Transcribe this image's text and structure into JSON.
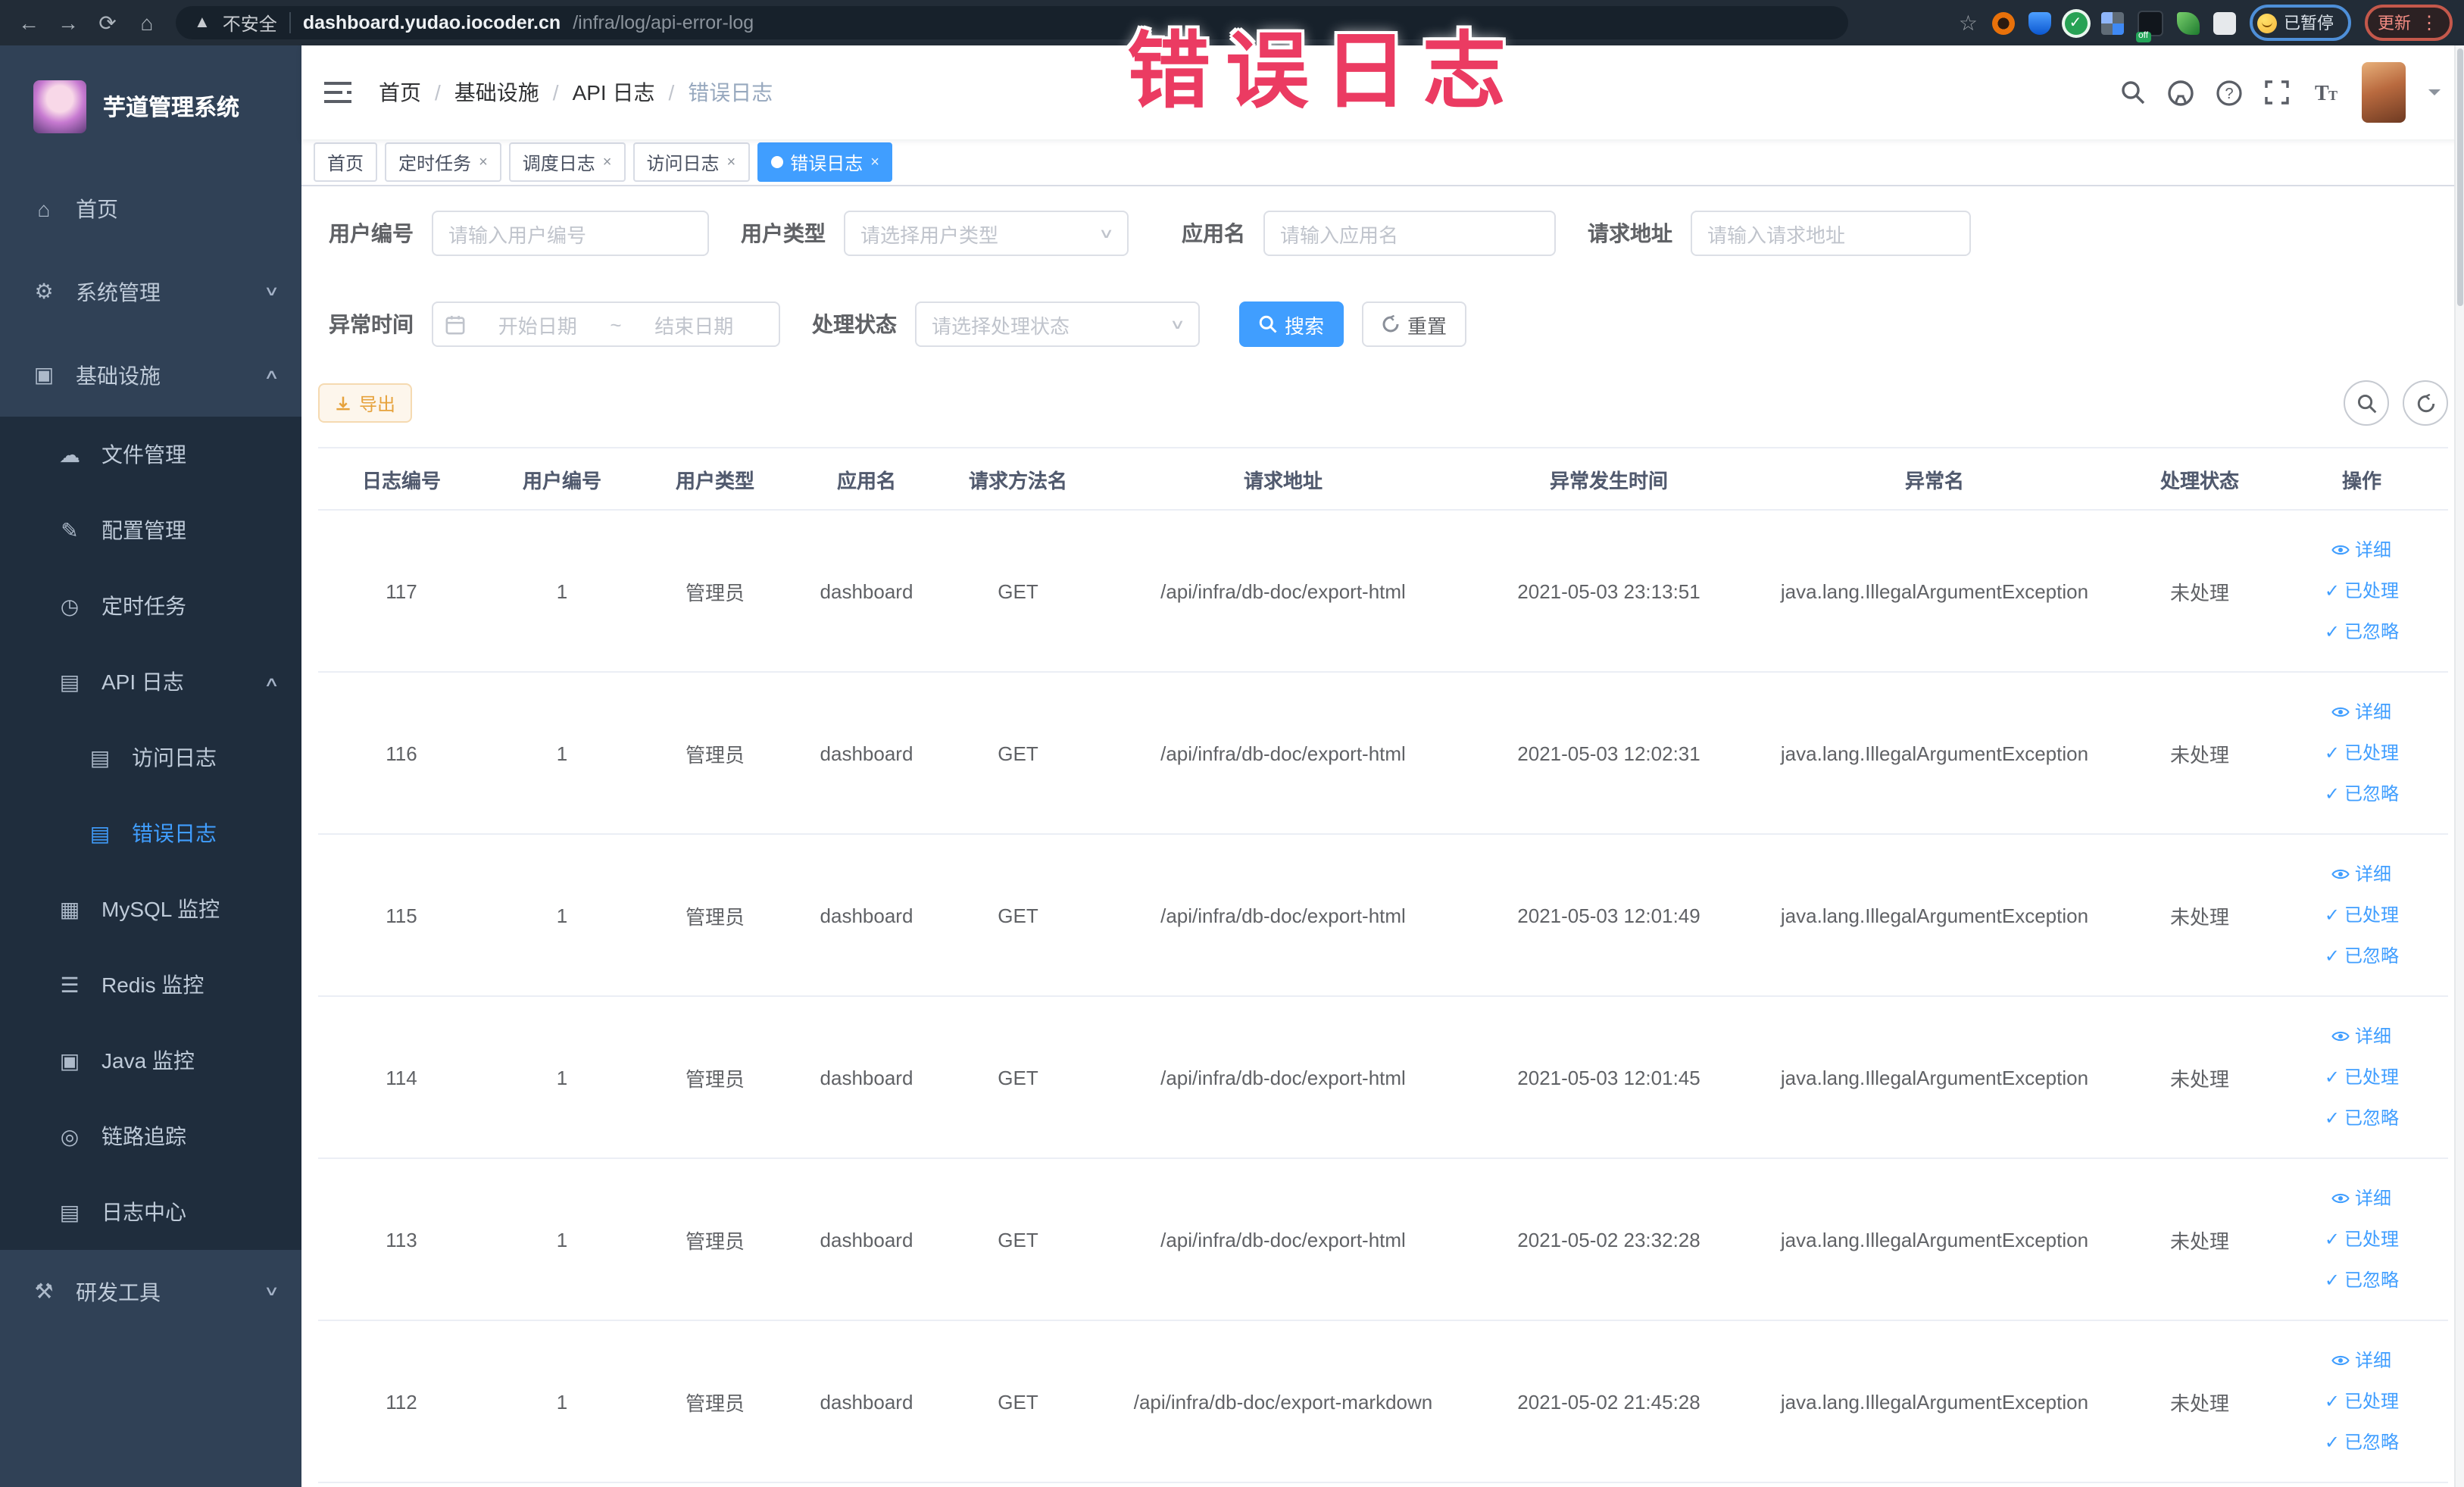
{
  "colors": {
    "primary": "#409EFF",
    "warning_text": "#E6A23C",
    "overlay_title": "#EB3B62",
    "sidebar_bg": "#304156",
    "sidebar_submenu_bg": "#1F2D3D",
    "active_tab_bg": "#409EFF"
  },
  "overlay": {
    "title": "错误日志"
  },
  "browser": {
    "security_label": "不安全",
    "url_host": "dashboard.yudao.iocoder.cn",
    "url_path": "/infra/log/api-error-log",
    "paused_badge": "已暂停",
    "update_button": "更新"
  },
  "sidebar": {
    "logo_title": "芋道管理系统",
    "items": [
      {
        "key": "home",
        "label": "首页",
        "icon": "home-icon",
        "level": 1
      },
      {
        "key": "system-management",
        "label": "系统管理",
        "icon": "gear-icon",
        "level": 1,
        "chevron": "down"
      },
      {
        "key": "infrastructure",
        "label": "基础设施",
        "icon": "infrastructure-icon",
        "level": 1,
        "chevron": "up"
      },
      {
        "key": "file-management",
        "label": "文件管理",
        "icon": "file-icon",
        "level": 2
      },
      {
        "key": "config-management",
        "label": "配置管理",
        "icon": "config-icon",
        "level": 2
      },
      {
        "key": "scheduled-tasks",
        "label": "定时任务",
        "icon": "timer-icon",
        "level": 2
      },
      {
        "key": "api-log",
        "label": "API 日志",
        "icon": "api-log-icon",
        "level": 2,
        "chevron": "up"
      },
      {
        "key": "access-log",
        "label": "访问日志",
        "icon": "access-log-icon",
        "level": 3
      },
      {
        "key": "error-log",
        "label": "错误日志",
        "icon": "error-log-icon",
        "level": 3,
        "active": true
      },
      {
        "key": "mysql-monitor",
        "label": "MySQL 监控",
        "icon": "mysql-icon",
        "level": 2
      },
      {
        "key": "redis-monitor",
        "label": "Redis 监控",
        "icon": "redis-icon",
        "level": 2
      },
      {
        "key": "java-monitor",
        "label": "Java 监控",
        "icon": "java-icon",
        "level": 2
      },
      {
        "key": "trace",
        "label": "链路追踪",
        "icon": "trace-icon",
        "level": 2
      },
      {
        "key": "log-center",
        "label": "日志中心",
        "icon": "log-center-icon",
        "level": 2
      },
      {
        "key": "dev-tools",
        "label": "研发工具",
        "icon": "dev-tools-icon",
        "level": 1,
        "chevron": "down"
      }
    ]
  },
  "breadcrumb": {
    "items": [
      "首页",
      "基础设施",
      "API 日志",
      "错误日志"
    ]
  },
  "tabs": [
    {
      "label": "首页",
      "closable": false,
      "active": false
    },
    {
      "label": "定时任务",
      "closable": true,
      "active": false
    },
    {
      "label": "调度日志",
      "closable": true,
      "active": false
    },
    {
      "label": "访问日志",
      "closable": true,
      "active": false
    },
    {
      "label": "错误日志",
      "closable": true,
      "active": true
    }
  ],
  "filters": {
    "user_id": {
      "label": "用户编号",
      "placeholder": "请输入用户编号"
    },
    "user_type": {
      "label": "用户类型",
      "placeholder": "请选择用户类型"
    },
    "app_name": {
      "label": "应用名",
      "placeholder": "请输入应用名"
    },
    "request_url": {
      "label": "请求地址",
      "placeholder": "请输入请求地址"
    },
    "exception_time": {
      "label": "异常时间",
      "start_placeholder": "开始日期",
      "separator": "~",
      "end_placeholder": "结束日期"
    },
    "process_status": {
      "label": "处理状态",
      "placeholder": "请选择处理状态"
    },
    "search_label": "搜索",
    "reset_label": "重置"
  },
  "toolbar": {
    "export_label": "导出"
  },
  "table": {
    "columns": [
      "日志编号",
      "用户编号",
      "用户类型",
      "应用名",
      "请求方法名",
      "请求地址",
      "异常发生时间",
      "异常名",
      "处理状态",
      "操作"
    ],
    "actions": [
      "详细",
      "已处理",
      "已忽略"
    ],
    "rows": [
      {
        "id": "117",
        "user_id": "1",
        "user_type": "管理员",
        "app_name": "dashboard",
        "method": "GET",
        "url": "/api/infra/db-doc/export-html",
        "time": "2021-05-03 23:13:51",
        "exception": "java.lang.IllegalArgumentException",
        "status": "未处理"
      },
      {
        "id": "116",
        "user_id": "1",
        "user_type": "管理员",
        "app_name": "dashboard",
        "method": "GET",
        "url": "/api/infra/db-doc/export-html",
        "time": "2021-05-03 12:02:31",
        "exception": "java.lang.IllegalArgumentException",
        "status": "未处理"
      },
      {
        "id": "115",
        "user_id": "1",
        "user_type": "管理员",
        "app_name": "dashboard",
        "method": "GET",
        "url": "/api/infra/db-doc/export-html",
        "time": "2021-05-03 12:01:49",
        "exception": "java.lang.IllegalArgumentException",
        "status": "未处理"
      },
      {
        "id": "114",
        "user_id": "1",
        "user_type": "管理员",
        "app_name": "dashboard",
        "method": "GET",
        "url": "/api/infra/db-doc/export-html",
        "time": "2021-05-03 12:01:45",
        "exception": "java.lang.IllegalArgumentException",
        "status": "未处理"
      },
      {
        "id": "113",
        "user_id": "1",
        "user_type": "管理员",
        "app_name": "dashboard",
        "method": "GET",
        "url": "/api/infra/db-doc/export-html",
        "time": "2021-05-02 23:32:28",
        "exception": "java.lang.IllegalArgumentException",
        "status": "未处理"
      },
      {
        "id": "112",
        "user_id": "1",
        "user_type": "管理员",
        "app_name": "dashboard",
        "method": "GET",
        "url": "/api/infra/db-doc/export-markdown",
        "time": "2021-05-02 21:45:28",
        "exception": "java.lang.IllegalArgumentException",
        "status": "未处理"
      }
    ]
  }
}
